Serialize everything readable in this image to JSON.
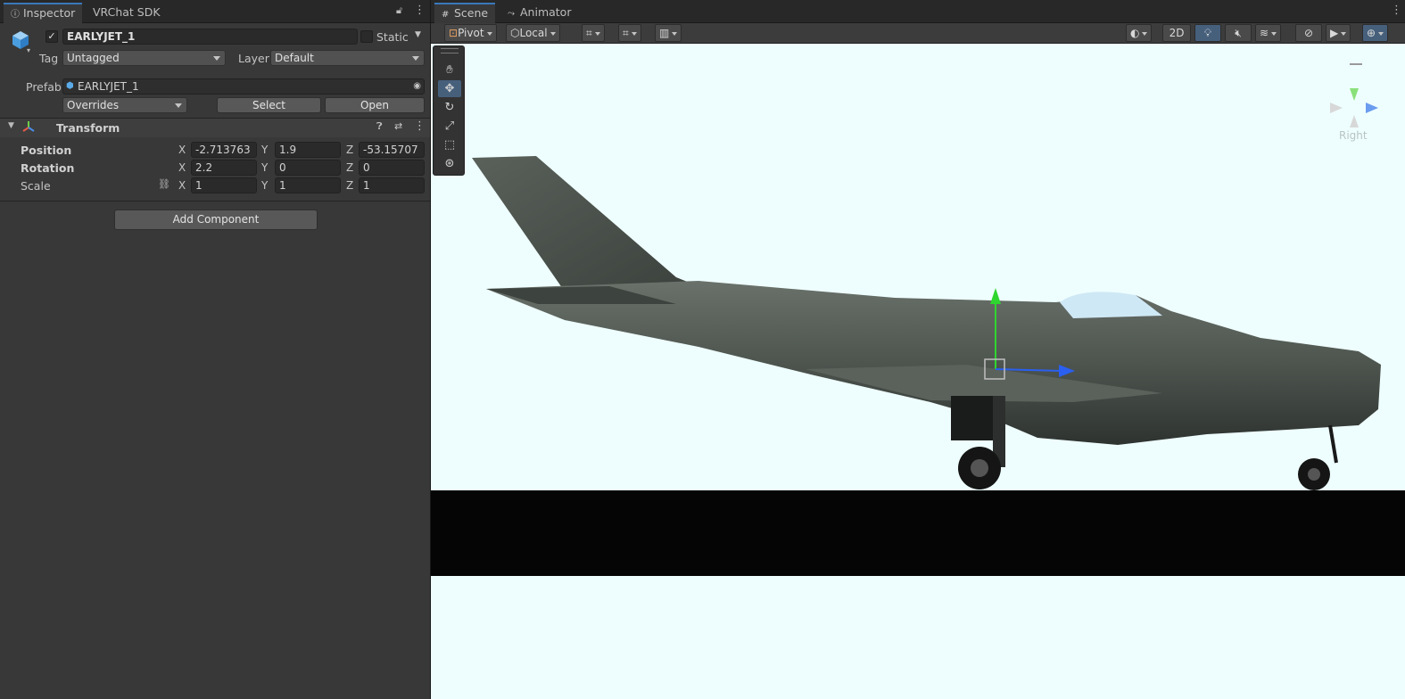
{
  "inspector": {
    "tabs": [
      {
        "label": "Inspector",
        "icon": "info-icon"
      },
      {
        "label": "VRChat SDK"
      }
    ],
    "object_name": "EARLYJET_1",
    "active_checked": true,
    "static_label": "Static",
    "tag_label": "Tag",
    "tag_value": "Untagged",
    "layer_label": "Layer",
    "layer_value": "Default",
    "prefab_label": "Prefab",
    "prefab_value": "EARLYJET_1",
    "overrides_label": "Overrides",
    "select_label": "Select",
    "open_label": "Open",
    "transform": {
      "title": "Transform",
      "position_label": "Position",
      "rotation_label": "Rotation",
      "scale_label": "Scale",
      "position": {
        "x": "-2.713763",
        "y": "1.9",
        "z": "-53.15707"
      },
      "rotation": {
        "x": "2.2",
        "y": "0",
        "z": "0"
      },
      "scale": {
        "x": "1",
        "y": "1",
        "z": "1"
      },
      "axis_x": "X",
      "axis_y": "Y",
      "axis_z": "Z"
    },
    "add_component_label": "Add Component"
  },
  "scene": {
    "tabs": [
      {
        "label": "Scene",
        "icon": "grid-icon"
      },
      {
        "label": "Animator",
        "icon": "animator-icon"
      }
    ],
    "toolbar": {
      "pivot_label": "Pivot",
      "local_label": "Local",
      "mode_2d_label": "2D"
    },
    "gizmo_label": "Right",
    "colors": {
      "sky": "#eefefe",
      "ground": "#050505",
      "axis_y": "#2fd62f",
      "axis_z": "#2a5ff0",
      "accent": "#3a79bb"
    }
  }
}
